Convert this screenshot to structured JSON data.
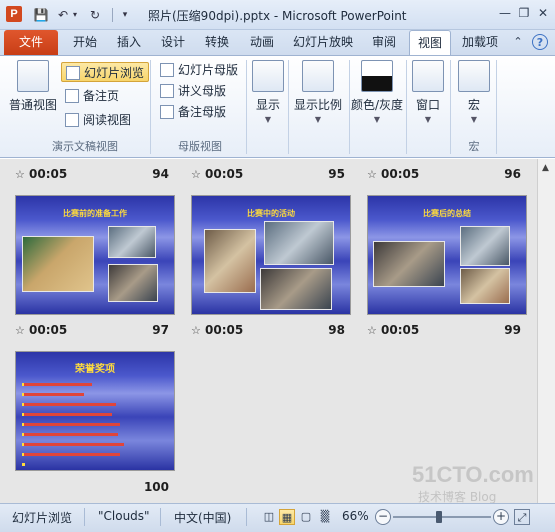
{
  "window": {
    "title": "照片(压缩90dpi).pptx - Microsoft PowerPoint",
    "app_icon_letter": "P"
  },
  "tabs": {
    "file": "文件",
    "items": [
      "开始",
      "插入",
      "设计",
      "转换",
      "动画",
      "幻灯片放映",
      "审阅",
      "视图",
      "加载项"
    ],
    "active": "视图"
  },
  "ribbon": {
    "presentation_views": {
      "label": "演示文稿视图",
      "normal": "普通视图",
      "slide_sorter": "幻灯片浏览",
      "notes_page": "备注页",
      "reading_view": "阅读视图"
    },
    "master_views": {
      "label": "母版视图",
      "slide_master": "幻灯片母版",
      "handout_master": "讲义母版",
      "notes_master": "备注母版"
    },
    "show": "显示",
    "zoom": "显示比例",
    "color_grayscale": "颜色/灰度",
    "window": "窗口",
    "macros": {
      "button": "宏",
      "label": "宏"
    }
  },
  "slides": [
    {
      "time": "00:05",
      "number": "94"
    },
    {
      "time": "00:05",
      "number": "95"
    },
    {
      "time": "00:05",
      "number": "96"
    },
    {
      "time": "00:05",
      "number": "97",
      "title": "比赛前的准备工作"
    },
    {
      "time": "00:05",
      "number": "98",
      "title": "比赛中的活动"
    },
    {
      "time": "00:05",
      "number": "99",
      "title": "比赛后的总结"
    },
    {
      "time": "",
      "number": "100",
      "title": "荣誉奖项"
    }
  ],
  "statusbar": {
    "view_name": "幻灯片浏览",
    "theme": "\"Clouds\"",
    "language": "中文(中国)",
    "zoom": "66%"
  },
  "watermark": {
    "main": "51CTO.com",
    "sub": "技术博客 Blog"
  }
}
